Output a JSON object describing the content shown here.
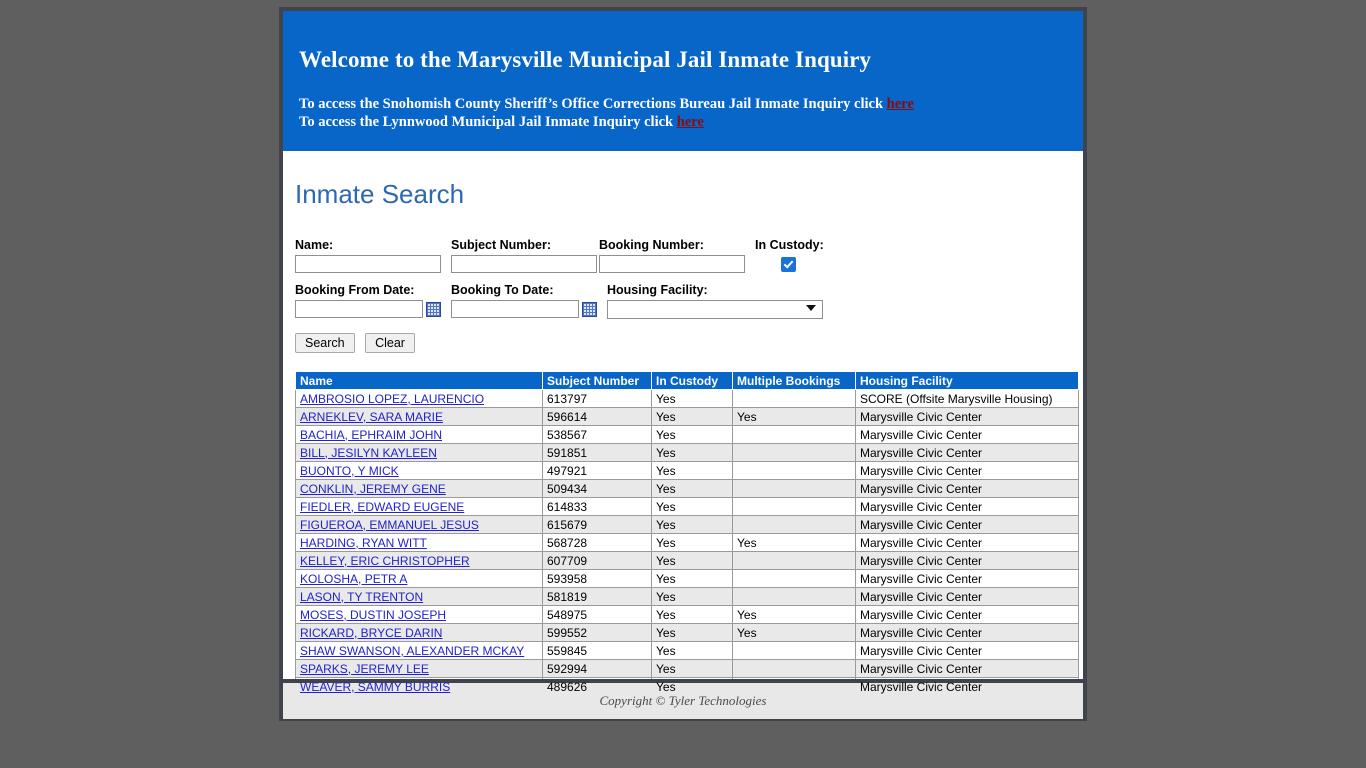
{
  "banner": {
    "title": "Welcome to the Marysville Municipal Jail Inmate Inquiry",
    "line1_prefix": "To access the Snohomish County Sheriff’s Office Corrections Bureau Jail Inmate Inquiry click ",
    "line1_link": "here",
    "line2_prefix": "To access the Lynnwood Municipal Jail Inmate Inquiry click ",
    "line2_link": "here",
    "background_color": "#0766c8",
    "link_color": "#8c0b0b"
  },
  "page": {
    "title": "Inmate Search",
    "title_color": "#2d68b2"
  },
  "search": {
    "name_label": "Name:",
    "name_value": "",
    "subject_number_label": "Subject Number:",
    "subject_number_value": "",
    "booking_number_label": "Booking Number:",
    "booking_number_value": "",
    "in_custody_label": "In Custody:",
    "in_custody_checked": "true",
    "booking_from_label": "Booking From Date:",
    "booking_from_value": "",
    "booking_to_label": "Booking To Date:",
    "booking_to_value": "",
    "housing_facility_label": "Housing Facility:",
    "housing_facility_value": "",
    "search_button": "Search",
    "clear_button": "Clear"
  },
  "results": {
    "columns": [
      "Name",
      "Subject Number",
      "In Custody",
      "Multiple Bookings",
      "Housing Facility"
    ],
    "rows": [
      {
        "name": "AMBROSIO LOPEZ, LAURENCIO",
        "subject_number": "613797",
        "in_custody": "Yes",
        "multiple_bookings": "",
        "housing_facility": "SCORE (Offsite Marysville Housing)"
      },
      {
        "name": "ARNEKLEV, SARA MARIE",
        "subject_number": "596614",
        "in_custody": "Yes",
        "multiple_bookings": "Yes",
        "housing_facility": "Marysville Civic Center"
      },
      {
        "name": "BACHIA, EPHRAIM JOHN",
        "subject_number": "538567",
        "in_custody": "Yes",
        "multiple_bookings": "",
        "housing_facility": "Marysville Civic Center"
      },
      {
        "name": "BILL, JESILYN KAYLEEN",
        "subject_number": "591851",
        "in_custody": "Yes",
        "multiple_bookings": "",
        "housing_facility": "Marysville Civic Center"
      },
      {
        "name": "BUONTO, Y MICK",
        "subject_number": "497921",
        "in_custody": "Yes",
        "multiple_bookings": "",
        "housing_facility": "Marysville Civic Center"
      },
      {
        "name": "CONKLIN, JEREMY GENE",
        "subject_number": "509434",
        "in_custody": "Yes",
        "multiple_bookings": "",
        "housing_facility": "Marysville Civic Center"
      },
      {
        "name": "FIEDLER, EDWARD EUGENE",
        "subject_number": "614833",
        "in_custody": "Yes",
        "multiple_bookings": "",
        "housing_facility": "Marysville Civic Center"
      },
      {
        "name": "FIGUEROA, EMMANUEL JESUS",
        "subject_number": "615679",
        "in_custody": "Yes",
        "multiple_bookings": "",
        "housing_facility": "Marysville Civic Center"
      },
      {
        "name": "HARDING, RYAN WITT",
        "subject_number": "568728",
        "in_custody": "Yes",
        "multiple_bookings": "Yes",
        "housing_facility": "Marysville Civic Center"
      },
      {
        "name": "KELLEY, ERIC CHRISTOPHER",
        "subject_number": "607709",
        "in_custody": "Yes",
        "multiple_bookings": "",
        "housing_facility": "Marysville Civic Center"
      },
      {
        "name": "KOLOSHA, PETR A",
        "subject_number": "593958",
        "in_custody": "Yes",
        "multiple_bookings": "",
        "housing_facility": "Marysville Civic Center"
      },
      {
        "name": "LASON, TY TRENTON",
        "subject_number": "581819",
        "in_custody": "Yes",
        "multiple_bookings": "",
        "housing_facility": "Marysville Civic Center"
      },
      {
        "name": "MOSES, DUSTIN JOSEPH",
        "subject_number": "548975",
        "in_custody": "Yes",
        "multiple_bookings": "Yes",
        "housing_facility": "Marysville Civic Center"
      },
      {
        "name": "RICKARD, BRYCE DARIN",
        "subject_number": "599552",
        "in_custody": "Yes",
        "multiple_bookings": "Yes",
        "housing_facility": "Marysville Civic Center"
      },
      {
        "name": "SHAW SWANSON, ALEXANDER MCKAY",
        "subject_number": "559845",
        "in_custody": "Yes",
        "multiple_bookings": "",
        "housing_facility": "Marysville Civic Center"
      },
      {
        "name": "SPARKS, JEREMY LEE",
        "subject_number": "592994",
        "in_custody": "Yes",
        "multiple_bookings": "",
        "housing_facility": "Marysville Civic Center"
      },
      {
        "name": "WEAVER, SAMMY BURRIS",
        "subject_number": "489626",
        "in_custody": "Yes",
        "multiple_bookings": "",
        "housing_facility": "Marysville Civic Center"
      }
    ]
  },
  "footer": {
    "copyright": "Copyright © Tyler Technologies"
  }
}
